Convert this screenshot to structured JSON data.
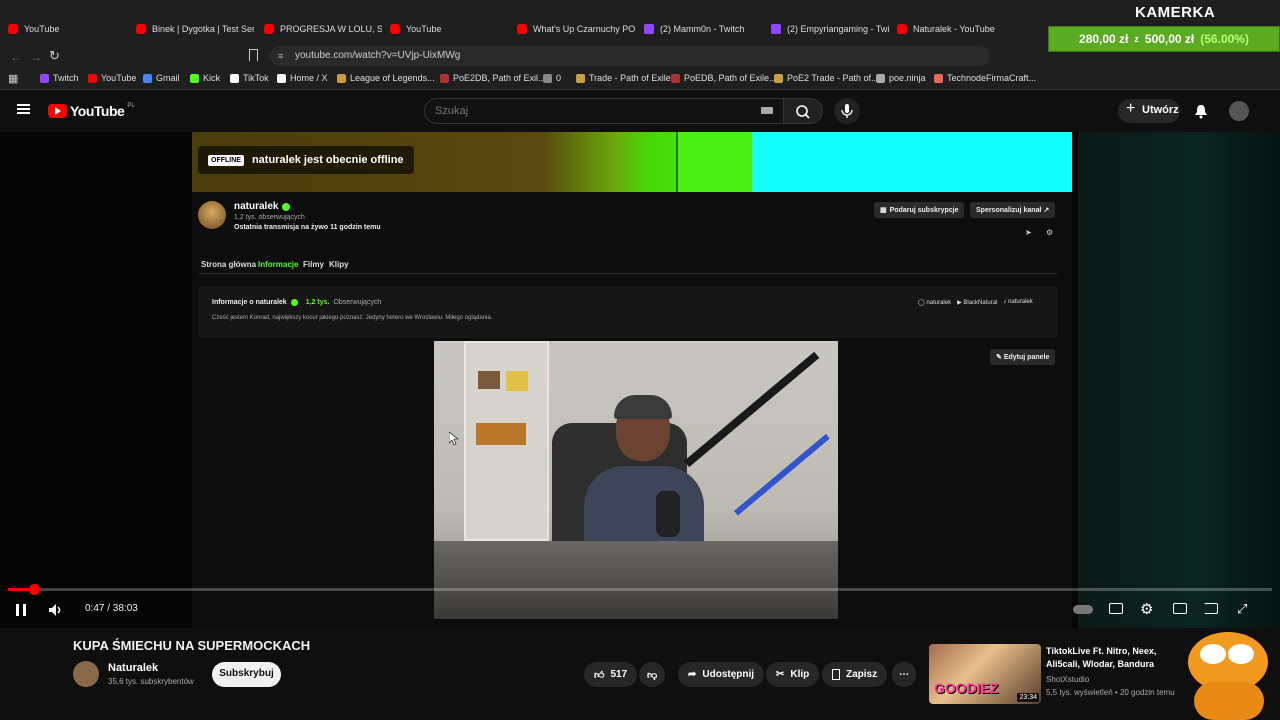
{
  "browser": {
    "tabs": [
      {
        "label": "YouTube",
        "kind": "yt"
      },
      {
        "label": "Binek | Dygotka | Test Serc",
        "kind": "yt"
      },
      {
        "label": "PROGRESJA W LOLU, SPRU",
        "kind": "yt"
      },
      {
        "label": "YouTube",
        "kind": "yt"
      },
      {
        "label": "What's Up Czarnuchy POP",
        "kind": "yt"
      },
      {
        "label": "(2) Mamm0n - Twitch",
        "kind": "tw"
      },
      {
        "label": "(2) Empyriangaming - Twi",
        "kind": "tw"
      },
      {
        "label": "Naturalek - YouTube",
        "kind": "yt"
      }
    ],
    "url": "youtube.com/watch?v=UVjp-UixMWg",
    "bookmarks": [
      "Twitch",
      "YouTube",
      "Gmail",
      "Kick",
      "TikTok",
      "Home / X",
      "League of Legends...",
      "PoE2DB, Path of Exil...",
      "0",
      "Trade - Path of Exile",
      "PoEDB, Path of Exile...",
      "PoE2 Trade - Path of...",
      "poe.ninja",
      "TechnodeFirmaCraft..."
    ]
  },
  "overlay": {
    "kamerka": "KAMERKA",
    "donate_current": "280,00 zł",
    "donate_sep": "z",
    "donate_goal": "500,00 zł",
    "donate_pct": "(56.00%)"
  },
  "youtube": {
    "logo": "YouTube",
    "region": "PL",
    "search_placeholder": "Szukaj",
    "create_label": "Utwórz"
  },
  "channel_page": {
    "offline_tag": "OFFLINE",
    "offline_text": "naturalek jest obecnie offline",
    "name": "naturalek",
    "followers": "1,2 tys. obserwujących",
    "last_stream": "Ostatnia transmisja na żywo 11 godzin temu",
    "gift_sub": "Podaruj subskrypcje",
    "customize": "Spersonalizuj kanał",
    "tabs": [
      "Strona główna",
      "Informacje",
      "Filmy",
      "Klipy"
    ],
    "active_tab": "Informacje",
    "about_title": "Informacje o naturalek",
    "about_followers": "1,2 tys.",
    "about_followers_label": "Obserwujących",
    "about_desc": "Cześć jestem Konrad, największy kocur jakiego poznasz. Jedyny hetero we Wrocławiu. Miłego oglądania.",
    "socials": [
      "naturalek",
      "BlackNatural",
      "naturalek"
    ],
    "edit_panels": "Edytuj panele"
  },
  "player": {
    "time": "0:47 / 38:03",
    "progress": 0.0206
  },
  "video_info": {
    "title": "KUPA ŚMIECHU NA SUPERMOCKACH",
    "channel": "Naturalek",
    "subs": "35,6 tys. subskrybentów",
    "subscribe": "Subskrybuj",
    "likes": "517",
    "share": "Udostępnij",
    "clip": "Klip",
    "save": "Zapisz"
  },
  "recommended": {
    "title": "TiktokLive Ft. Nitro, Neex, Ali5cali, Wlodar, Bandura",
    "channel": "ShotXstudio",
    "meta": "5,5 tys. wyświetleń • 20 godzin temu",
    "duration": "23:34",
    "thumb_text": "GOODIEZ"
  }
}
